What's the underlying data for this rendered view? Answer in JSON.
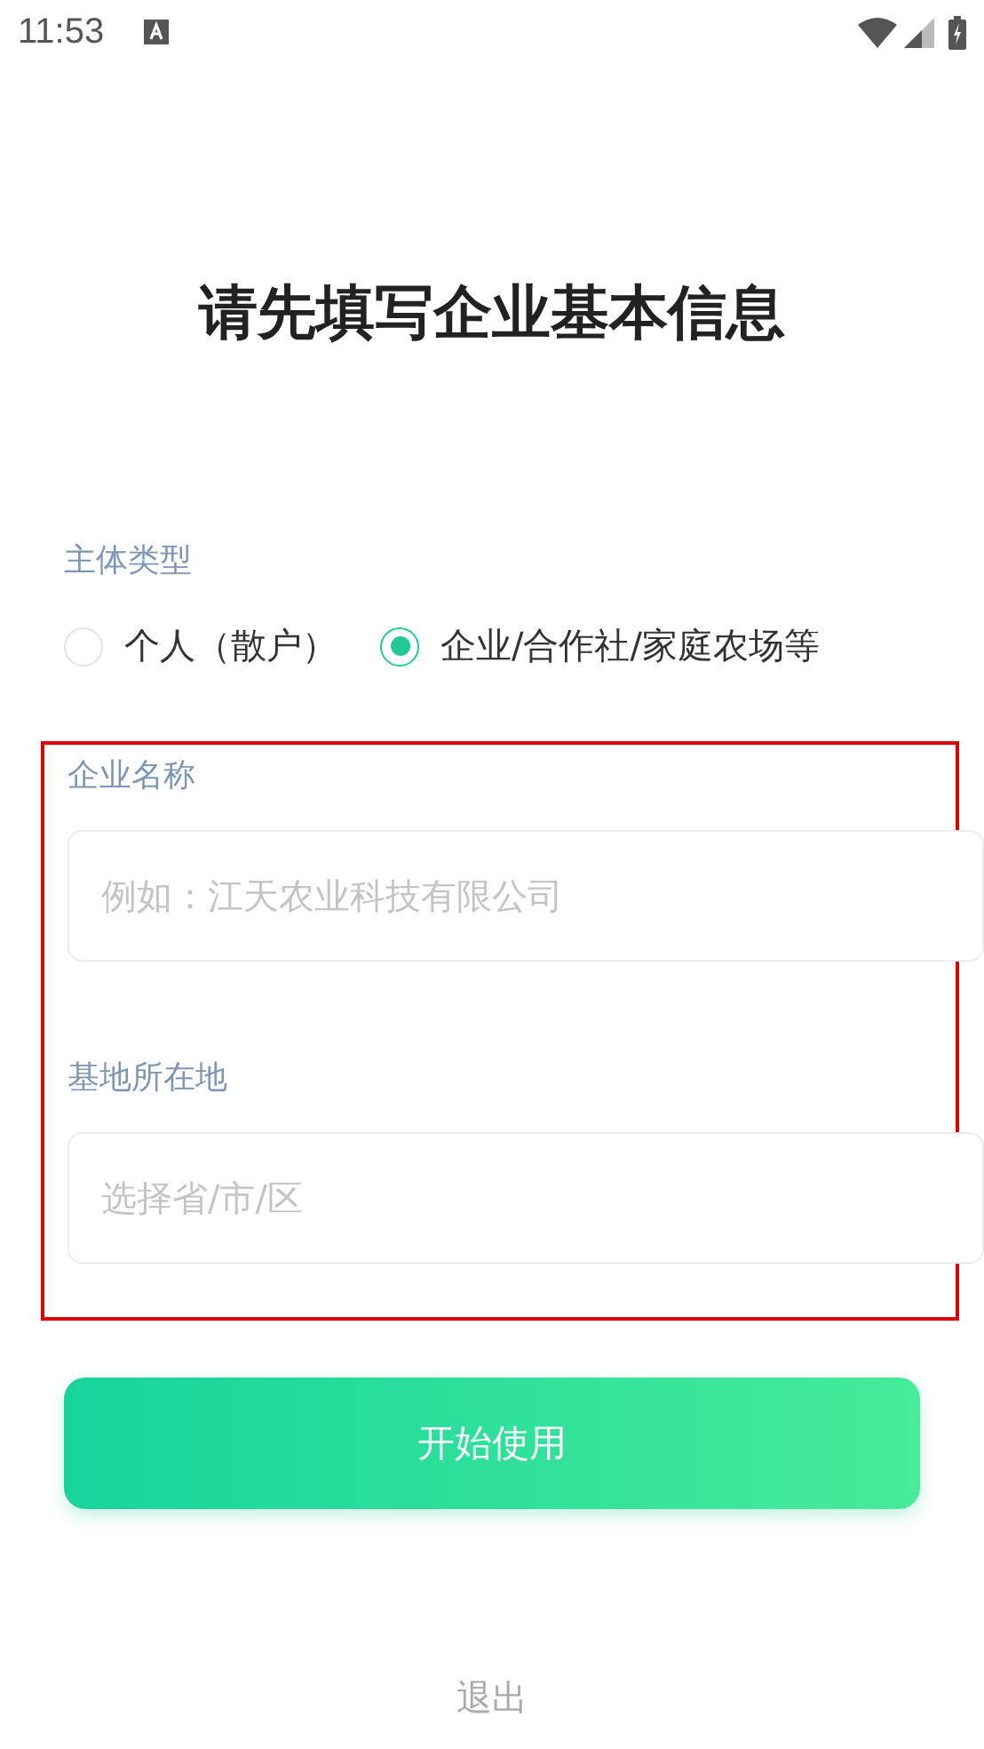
{
  "status_bar": {
    "time": "11:53"
  },
  "title": "请先填写企业基本信息",
  "entity_type": {
    "label": "主体类型",
    "options": [
      {
        "label": "个人（散户）",
        "selected": false
      },
      {
        "label": "企业/合作社/家庭农场等",
        "selected": true
      }
    ]
  },
  "highlighted_section": {
    "highlighted": true,
    "fields": [
      {
        "label": "企业名称",
        "placeholder": "例如：江天农业科技有限公司"
      },
      {
        "label": "基地所在地",
        "placeholder": "选择省/市/区"
      }
    ]
  },
  "start_button": "开始使用",
  "exit_link": "退出"
}
